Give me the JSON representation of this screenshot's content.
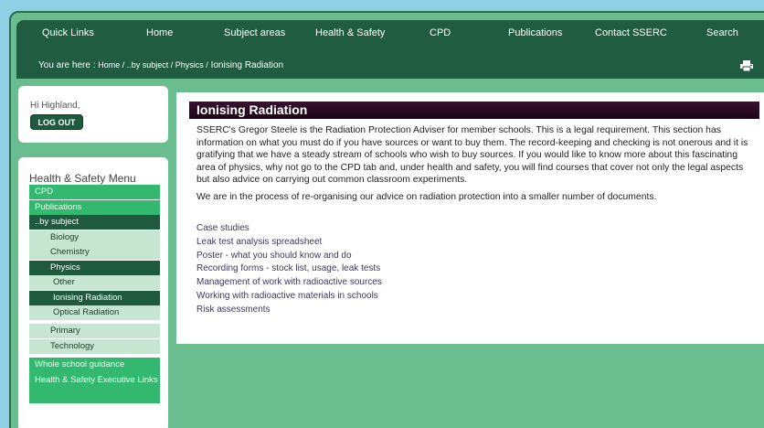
{
  "nav": {
    "items": [
      "Quick Links",
      "Home",
      "Subject areas",
      "Health & Safety",
      "CPD",
      "Publications",
      "Contact SSERC",
      "Search"
    ],
    "breadcrumb_prefix": "You are here :",
    "breadcrumb_path": "Home / ..by subject / Physics /",
    "breadcrumb_current": "Ionising Radiation",
    "print_icon": "printer-icon"
  },
  "user": {
    "greeting": "Hi Highland,",
    "logout_label": "LOG OUT"
  },
  "menu": {
    "title": "Health & Safety Menu",
    "items": [
      {
        "label": "CPD"
      },
      {
        "label": "Publications"
      },
      {
        "label": "..by subject"
      },
      {
        "label": "Biology"
      },
      {
        "label": "Chemistry"
      },
      {
        "label": "Physics"
      },
      {
        "label": "Other"
      },
      {
        "label": "Ionising Radiation"
      },
      {
        "label": "Optical Radiation"
      },
      {
        "label": "Primary"
      },
      {
        "label": "Technology"
      },
      {
        "label": "Whole school guidance"
      },
      {
        "label": "Health & Safety Executive Links"
      }
    ]
  },
  "content": {
    "title": "Ionising Radiation",
    "paragraph1": "SSERC's Gregor Steele is the Radiation Protection Adviser for member schools. This is a legal requirement. This section has information on what you must do if you have sources or want to buy them. The record-keeping and checking is not onerous and it is gratifying that we have a steady stream of schools who wish to buy sources. If you would like to know more about this fascinating area of physics, why not go to the CPD tab and, under health and safety, you will find courses that cover not only the legal aspects but also advice on carrying out common classroom experiments.",
    "paragraph2": "We are in the process of re-organising our advice on radiation protection into a smaller number of documents.",
    "links": [
      "Case studies",
      "Leak test analysis spreadsheet",
      "Poster - what you should know and do",
      "Recording forms - stock list, usage, leak tests",
      "Management of work with radioactive sources",
      "Working with radioactive materials in schools",
      "Risk assessments"
    ]
  },
  "colors": {
    "page_background": "#8fd0e4",
    "frame_green": "#69bd8f",
    "nav_dark_green": "#1f5c40",
    "menu_bright_green": "#33b870",
    "menu_pale_green": "#c7e6d2",
    "title_bar_purple": "#2a0b24"
  }
}
